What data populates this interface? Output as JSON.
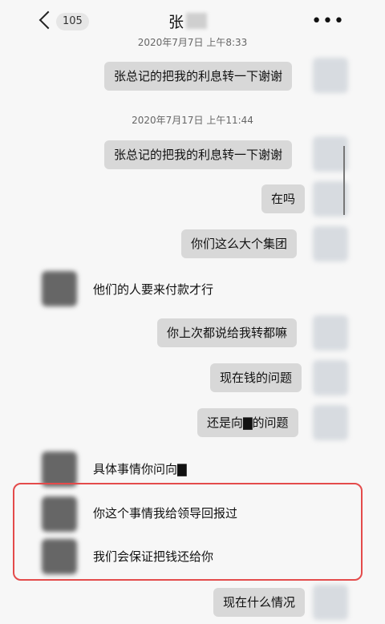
{
  "header": {
    "badge": "105",
    "title": "张",
    "more": "•••"
  },
  "timestamps": {
    "t1": "2020年7月7日 上午8:33",
    "t2": "2020年7月17日 上午11:44"
  },
  "messages": [
    {
      "side": "me",
      "text": "张总记的把我的利息转一下谢谢"
    },
    {
      "side": "me",
      "text": "张总记的把我的利息转一下谢谢"
    },
    {
      "side": "me",
      "text": "在吗"
    },
    {
      "side": "me",
      "text": "你们这么大个集团"
    },
    {
      "side": "them",
      "text": "他们的人要来付款才行"
    },
    {
      "side": "me",
      "text": "你上次都说给我转都嘛"
    },
    {
      "side": "me",
      "text": "现在钱的问题"
    },
    {
      "side": "me",
      "text": "还是向▇的问题"
    },
    {
      "side": "them",
      "text": "具体事情你问向▇"
    },
    {
      "side": "them",
      "text": "你这个事情我给领导回报过"
    },
    {
      "side": "them",
      "text": "我们会保证把钱还给你"
    },
    {
      "side": "me",
      "text": "现在什么情况"
    }
  ]
}
